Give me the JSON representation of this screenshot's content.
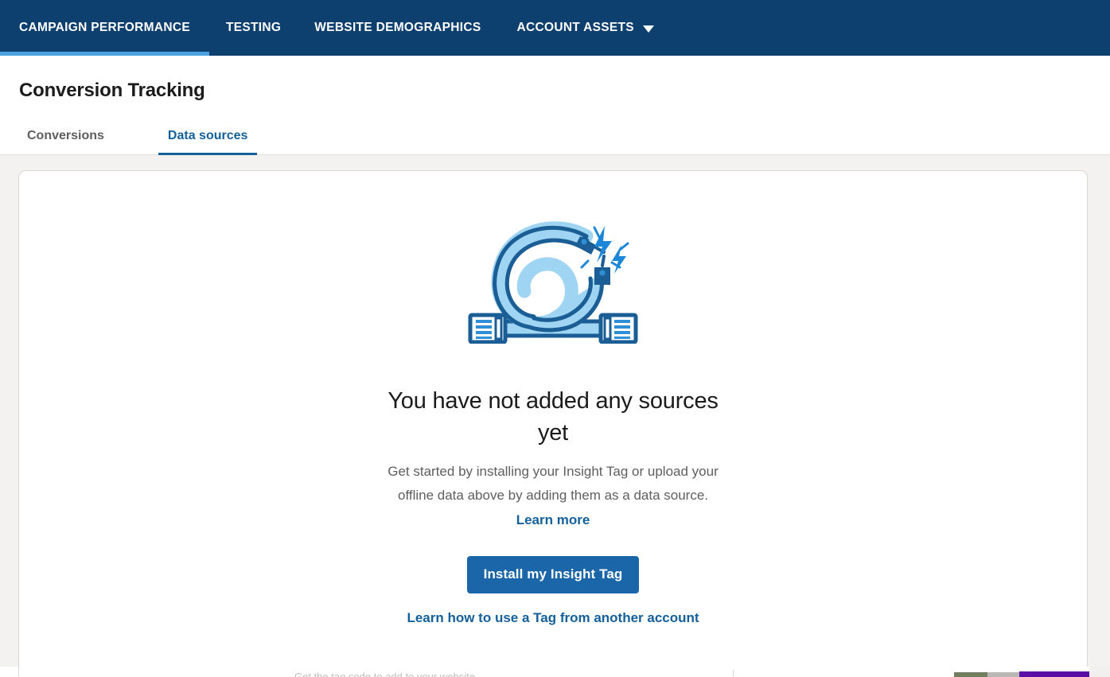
{
  "topnav": {
    "background_color": "#0e406f",
    "active_indicator_color": "#4aa3df",
    "items": [
      {
        "label": "CAMPAIGN PERFORMANCE",
        "active": true
      },
      {
        "label": "TESTING",
        "active": false
      },
      {
        "label": "WEBSITE DEMOGRAPHICS",
        "active": false
      },
      {
        "label": "ACCOUNT ASSETS",
        "active": false,
        "has_dropdown": true
      }
    ]
  },
  "header": {
    "title": "Conversion Tracking"
  },
  "subtabs": {
    "active_color": "#14609a",
    "items": [
      {
        "label": "Conversions",
        "active": false
      },
      {
        "label": "Data sources",
        "active": true
      }
    ]
  },
  "empty_state": {
    "illustration": "disconnected-cable-icon",
    "title": "You have not added any sources yet",
    "body_text": "Get started by installing your Insight Tag or upload your offline data above by adding them as a data source.",
    "inline_link": "Learn more",
    "primary_button": "Install my Insight Tag",
    "secondary_link": "Learn how to use a Tag from another account",
    "primary_button_color": "#1a66a8",
    "link_color": "#14609a"
  },
  "bottom_strip": {
    "tagline": "Get the tag code to add to your website"
  }
}
